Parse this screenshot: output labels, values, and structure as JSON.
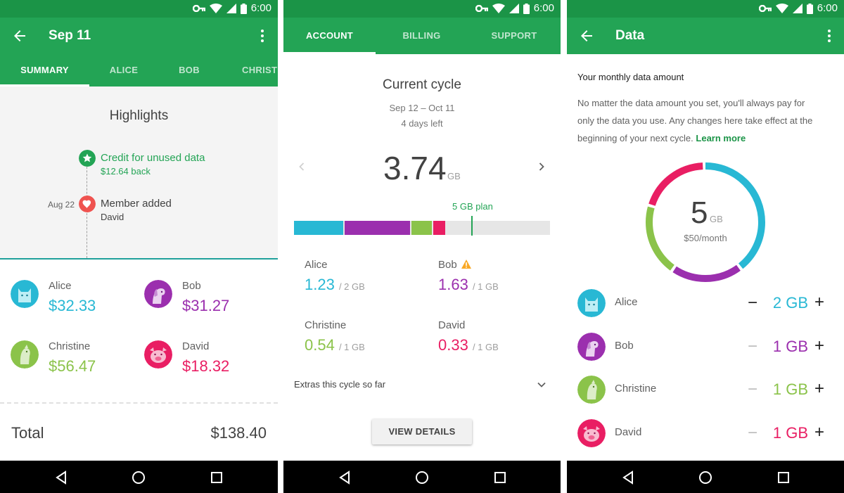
{
  "status_bar": {
    "time": "6:00"
  },
  "colors": {
    "primary": "#23a455",
    "status": "#1b9447",
    "alice": "#28b8d4",
    "bob": "#9b2fae",
    "christine": "#8bc34a",
    "david": "#e91e63",
    "warning": "#f9a825"
  },
  "screen_summary": {
    "title": "Sep 11",
    "tabs": [
      {
        "label": "SUMMARY",
        "active": true
      },
      {
        "label": "ALICE",
        "active": false
      },
      {
        "label": "BOB",
        "active": false
      },
      {
        "label": "CHRISTI",
        "active": false
      }
    ],
    "highlights": {
      "title": "Highlights",
      "events": [
        {
          "title": "Credit for unused data",
          "subtitle": "$12.64 back",
          "date": "",
          "icon": "star-icon"
        },
        {
          "title": "Member added",
          "subtitle": "David",
          "date": "Aug 22",
          "icon": "heart-icon"
        }
      ]
    },
    "members": [
      {
        "name": "Alice",
        "amount": "$32.33",
        "avatar": "cat-avatar-icon"
      },
      {
        "name": "Bob",
        "amount": "$31.27",
        "avatar": "dog-avatar-icon"
      },
      {
        "name": "Christine",
        "amount": "$56.47",
        "avatar": "bird-avatar-icon"
      },
      {
        "name": "David",
        "amount": "$18.32",
        "avatar": "pig-avatar-icon"
      }
    ],
    "total_label": "Total",
    "total_value": "$138.40"
  },
  "screen_account": {
    "tabs": [
      {
        "label": "ACCOUNT",
        "active": true
      },
      {
        "label": "BILLING",
        "active": false
      },
      {
        "label": "SUPPORT",
        "active": false
      }
    ],
    "cycle_title": "Current cycle",
    "cycle_dates": "Sep 12 – Oct 11",
    "days_left": "4 days left",
    "usage_value": "3.74",
    "usage_unit": "GB",
    "plan_label": "5 GB plan",
    "bar": {
      "total_gb": 6.25,
      "plan_gb": 5,
      "segments": [
        {
          "name": "Alice",
          "gb": 1.23
        },
        {
          "name": "Bob",
          "gb": 1.63
        },
        {
          "name": "Christine",
          "gb": 0.54
        },
        {
          "name": "David",
          "gb": 0.33
        }
      ]
    },
    "usage": [
      {
        "name": "Alice",
        "value": "1.23",
        "limit": "/ 2 GB",
        "warning": false
      },
      {
        "name": "Bob",
        "value": "1.63",
        "limit": "/ 1 GB",
        "warning": true
      },
      {
        "name": "Christine",
        "value": "0.54",
        "limit": "/ 1 GB",
        "warning": false
      },
      {
        "name": "David",
        "value": "0.33",
        "limit": "/ 1 GB",
        "warning": false
      }
    ],
    "extras_label": "Extras this cycle so far",
    "view_details": "VIEW DETAILS"
  },
  "screen_data": {
    "title": "Data",
    "heading": "Your monthly data amount",
    "body": "No matter the data amount you set, you'll always pay for only the data you use. Any changes here take effect at the beginning of your next cycle.",
    "learn_more": "Learn more",
    "total_value": "5",
    "total_unit": "GB",
    "price": "$50/month",
    "allocations": [
      {
        "name": "Alice",
        "value": "2 GB",
        "gb": 2
      },
      {
        "name": "Bob",
        "value": "1 GB",
        "gb": 1
      },
      {
        "name": "Christine",
        "value": "1 GB",
        "gb": 1
      },
      {
        "name": "David",
        "value": "1 GB",
        "gb": 1
      }
    ]
  }
}
